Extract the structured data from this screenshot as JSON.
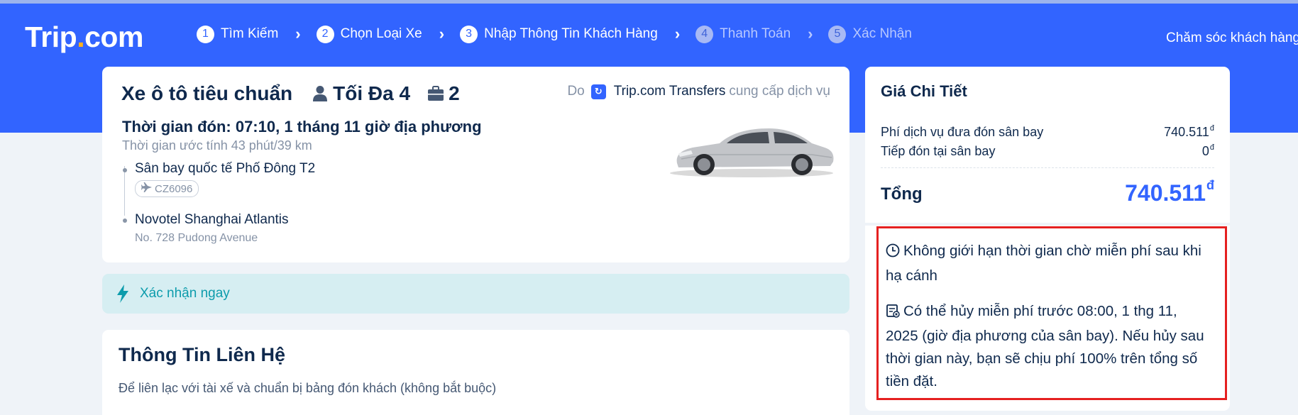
{
  "brand": {
    "name_main": "Trip",
    "name_dot": ".",
    "name_tail": "com"
  },
  "steps": [
    {
      "num": "1",
      "label": "Tìm Kiếm"
    },
    {
      "num": "2",
      "label": "Chọn Loại Xe"
    },
    {
      "num": "3",
      "label": "Nhập Thông Tin Khách Hàng"
    },
    {
      "num": "4",
      "label": "Thanh Toán"
    },
    {
      "num": "5",
      "label": "Xác Nhận"
    }
  ],
  "header": {
    "support": "Chăm sóc khách hàng"
  },
  "car": {
    "title": "Xe ô tô tiêu chuẩn",
    "max_passengers": "Tối Đa 4",
    "luggage": "2",
    "provider_prefix": "Do",
    "provider_name": "Trip.com Transfers",
    "provider_suffix": "cung cấp dịch vụ",
    "pickup_time": "Thời gian đón: 07:10, 1 tháng 11 giờ địa phương",
    "estimate": "Thời gian ước tính 43 phút/39 km",
    "pickup_location": "Sân bay quốc tế Phố Đông T2",
    "flight": "CZ6096",
    "dropoff_location": "Novotel Shanghai Atlantis",
    "dropoff_address": "No. 728 Pudong Avenue"
  },
  "confirm": {
    "label": "Xác nhận ngay"
  },
  "contact": {
    "title": "Thông Tin Liên Hệ",
    "subtitle": "Để liên lạc với tài xế và chuẩn bị bảng đón khách (không bắt buộc)"
  },
  "price": {
    "title": "Giá Chi Tiết",
    "rows": [
      {
        "label": "Phí dịch vụ đưa đón sân bay",
        "value": "740.511"
      },
      {
        "label": "Tiếp đón tại sân bay",
        "value": "0"
      }
    ],
    "currency": "đ",
    "total_label": "Tổng",
    "total_value": "740.511"
  },
  "policy": {
    "waiting": "Không giới hạn thời gian chờ miễn phí sau khi hạ cánh",
    "cancellation": "Có thể hủy miễn phí trước 08:00, 1 thg 11, 2025 (giờ địa phương của sân bay). Nếu hủy sau thời gian này, bạn sẽ chịu phí 100% trên tổng số tiền đặt."
  },
  "colors": {
    "primary": "#3264ff",
    "accent_dot": "#ffb11b",
    "instant_bg": "#d6eef2",
    "instant_text": "#0d9cac",
    "highlight_border": "#e52020"
  },
  "icons": [
    "person-icon",
    "luggage-icon",
    "provider-logo-icon",
    "airplane-icon",
    "bolt-icon",
    "clock-icon",
    "cancel-policy-icon",
    "chevron-right-icon"
  ]
}
